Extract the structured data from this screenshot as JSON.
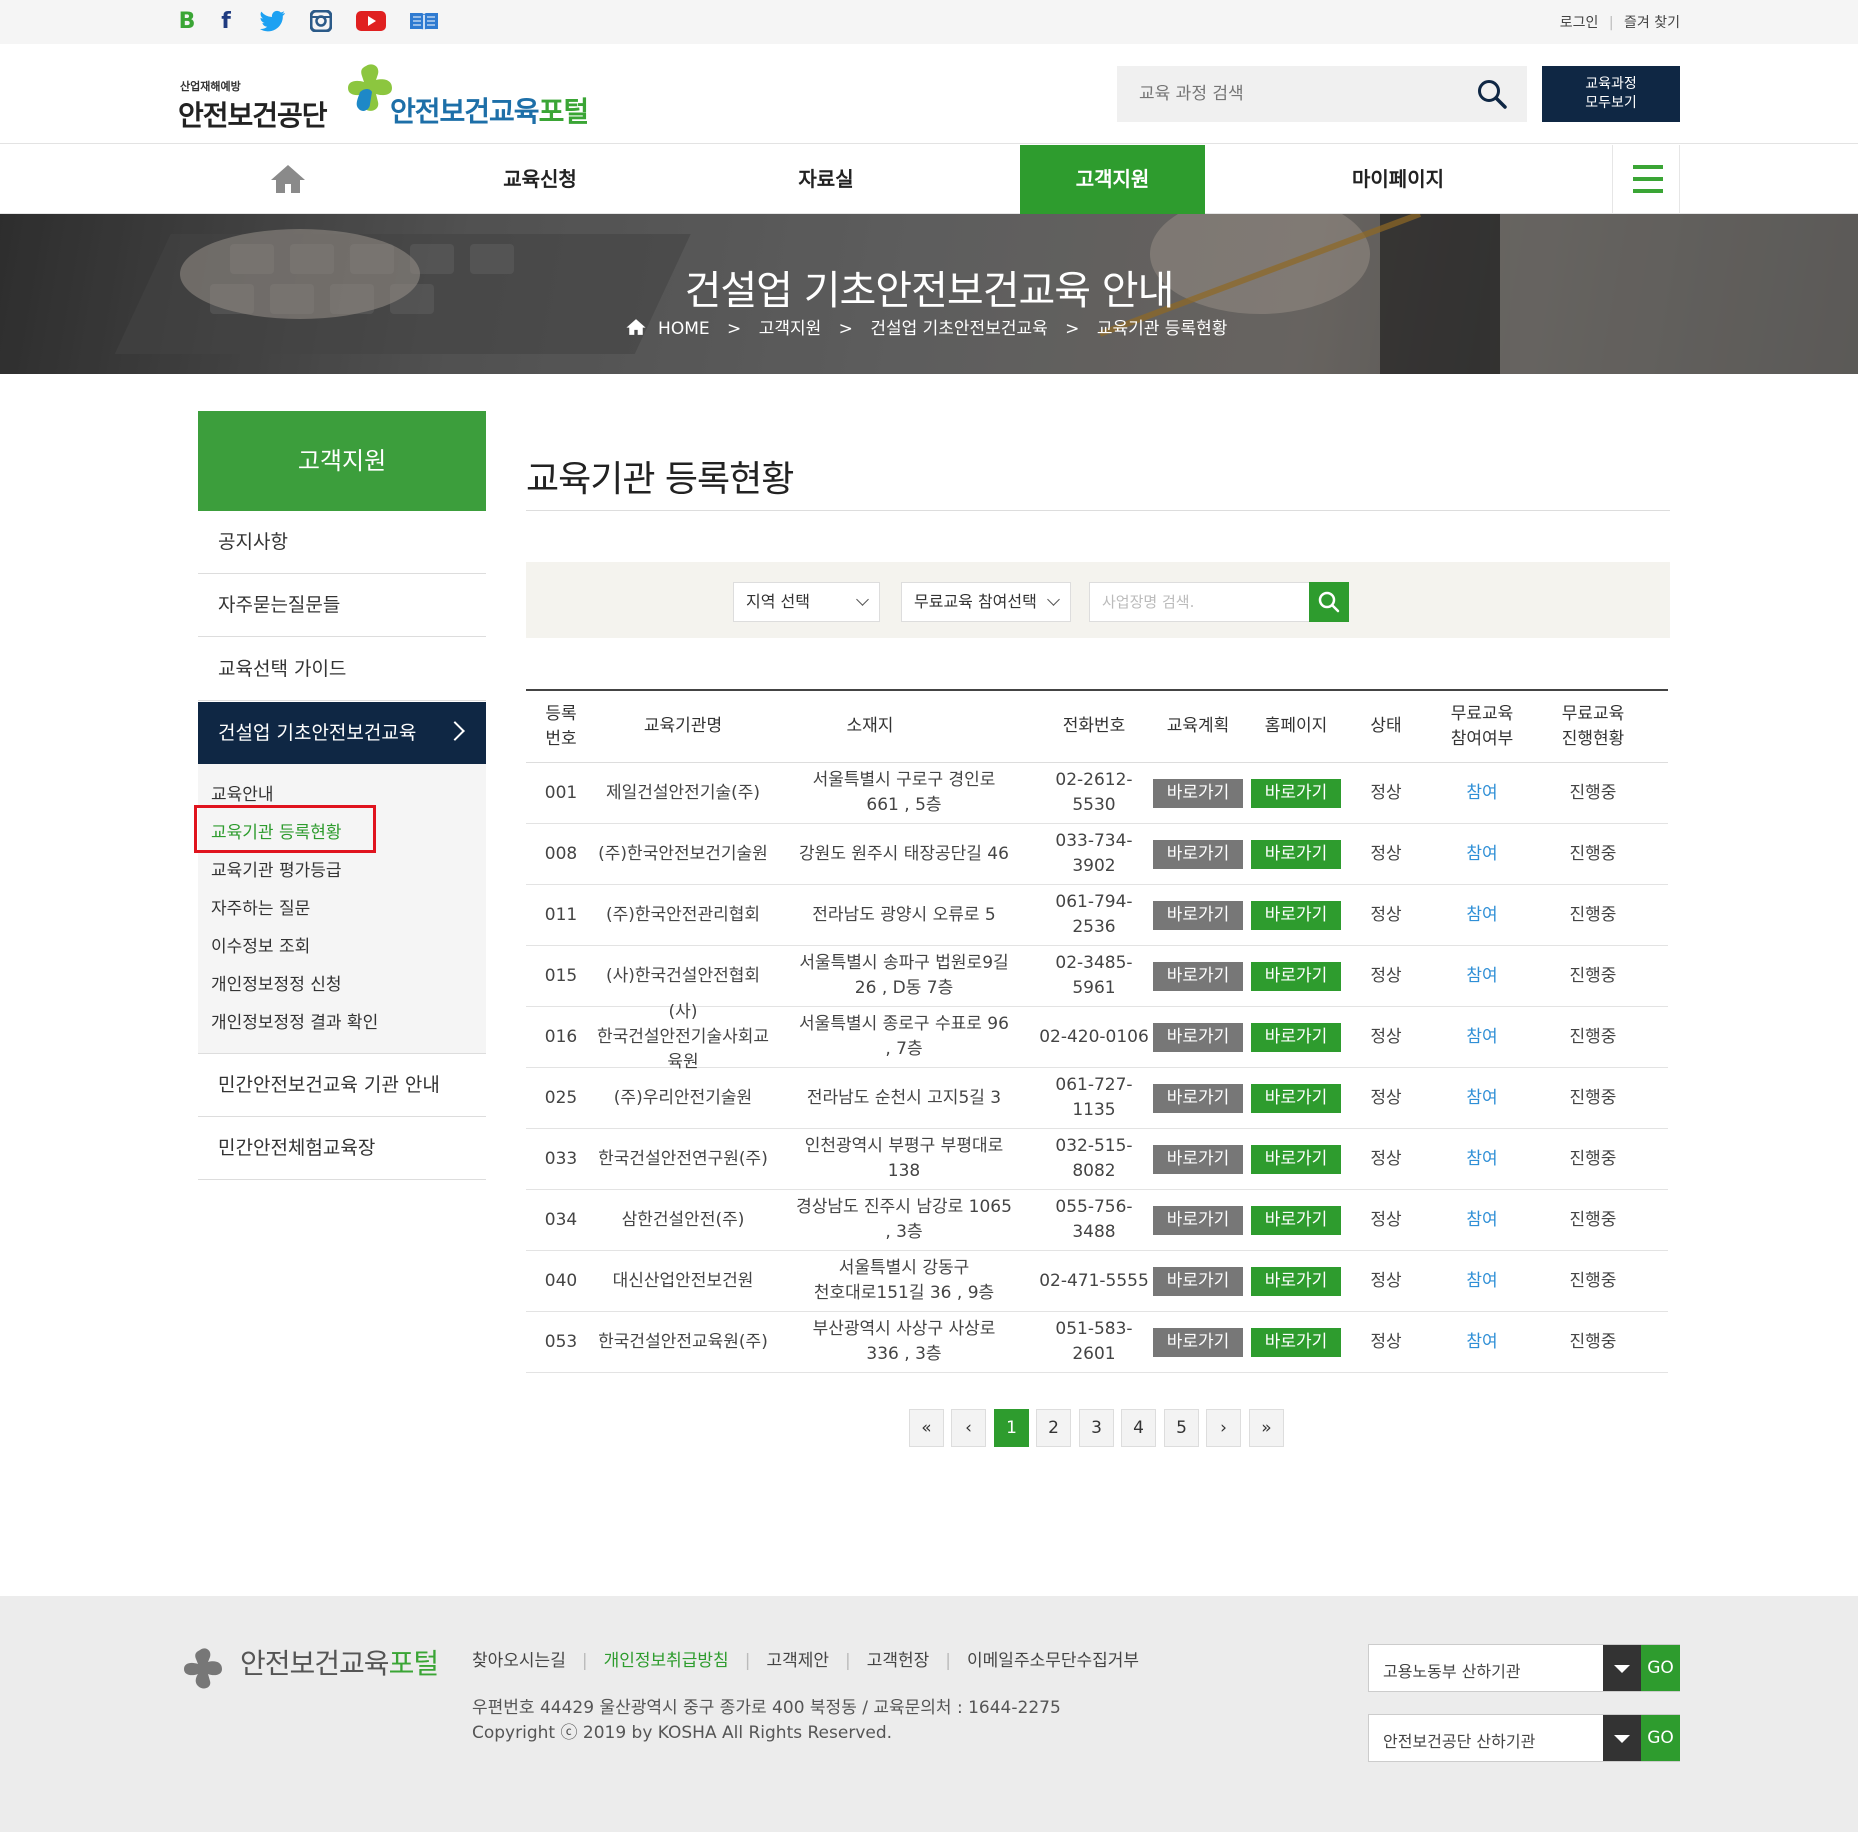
{
  "topbar": {
    "social_icons": [
      "blog-icon",
      "facebook-icon",
      "twitter-icon",
      "instagram-icon",
      "youtube-icon",
      "book-icon"
    ],
    "login": "로그인",
    "favorite": "즐겨 찾기"
  },
  "header": {
    "logo_small": "산업재해예방",
    "logo_main": "안전보건공단",
    "portal_blue": "안전보건교육",
    "portal_green": "포털",
    "search_placeholder": "교육 과정 검색",
    "all_courses_line1": "교육과정",
    "all_courses_line2": "모두보기"
  },
  "gnb": {
    "items": [
      "교육신청",
      "자료실",
      "고객지원",
      "마이페이지"
    ],
    "active": "고객지원"
  },
  "banner": {
    "title": "건설업 기초안전보건교육 안내",
    "breadcrumb": [
      "HOME",
      "고객지원",
      "건설업 기초안전보건교육",
      "교육기관 등록현황"
    ]
  },
  "lnb": {
    "title": "고객지원",
    "items": [
      "공지사항",
      "자주묻는질문들",
      "교육선택 가이드",
      "건설업 기초안전보건교육",
      "민간안전보건교육 기관 안내",
      "민간안전체험교육장"
    ],
    "sub_items": [
      "교육안내",
      "교육기관 등록현황",
      "교육기관 평가등급",
      "자주하는 질문",
      "이수정보 조회",
      "개인정보정정 신청",
      "개인정보정정 결과 확인"
    ]
  },
  "content": {
    "page_title": "교육기관 등록현황",
    "filter": {
      "region": "지역 선택",
      "free_edu": "무료교육 참여선택",
      "search_placeholder": "사업장명 검색."
    },
    "table": {
      "headers": {
        "no_1": "등록",
        "no_2": "번호",
        "name": "교육기관명",
        "address": "소재지",
        "phone": "전화번호",
        "plan": "교육계획",
        "homepage": "홈페이지",
        "status": "상태",
        "free_join_1": "무료교육",
        "free_join_2": "참여여부",
        "free_prog_1": "무료교육",
        "free_prog_2": "진행현황"
      },
      "button_label": "바로가기",
      "rows": [
        {
          "no": "001",
          "name": "제일건설안전기술(주)",
          "addr1": "서울특별시 구로구 경인로",
          "addr2": "661 , 5층",
          "phone": "02-2612-5530",
          "status": "정상",
          "join": "참여",
          "prog": "진행중"
        },
        {
          "no": "008",
          "name": "(주)한국안전보건기술원",
          "addr1": "강원도 원주시 태장공단길 46",
          "addr2": "",
          "phone": "033-734-3902",
          "status": "정상",
          "join": "참여",
          "prog": "진행중"
        },
        {
          "no": "011",
          "name": "(주)한국안전관리협회",
          "addr1": "전라남도 광양시 오류로 5",
          "addr2": "",
          "phone": "061-794-2536",
          "status": "정상",
          "join": "참여",
          "prog": "진행중"
        },
        {
          "no": "015",
          "name": "(사)한국건설안전협회",
          "addr1": "서울특별시 송파구 법원로9길",
          "addr2": "26 , D동 7층",
          "phone": "02-3485-5961",
          "status": "정상",
          "join": "참여",
          "prog": "진행중"
        },
        {
          "no": "016",
          "name": "(사)",
          "name2": "한국건설안전기술사회교육원",
          "addr1": "서울특별시 종로구 수표로 96",
          "addr2": ", 7층",
          "phone": "02-420-0106",
          "status": "정상",
          "join": "참여",
          "prog": "진행중"
        },
        {
          "no": "025",
          "name": "(주)우리안전기술원",
          "addr1": "전라남도 순천시 고지5길 3",
          "addr2": "",
          "phone": "061-727-1135",
          "status": "정상",
          "join": "참여",
          "prog": "진행중"
        },
        {
          "no": "033",
          "name": "한국건설안전연구원(주)",
          "addr1": "인천광역시 부평구 부평대로",
          "addr2": "138",
          "phone": "032-515-8082",
          "status": "정상",
          "join": "참여",
          "prog": "진행중"
        },
        {
          "no": "034",
          "name": "삼한건설안전(주)",
          "addr1": "경상남도 진주시 남강로 1065",
          "addr2": ", 3층",
          "phone": "055-756-3488",
          "status": "정상",
          "join": "참여",
          "prog": "진행중"
        },
        {
          "no": "040",
          "name": "대신산업안전보건원",
          "addr1": "서울특별시 강동구",
          "addr2": "천호대로151길 36 , 9층",
          "phone": "02-471-5555",
          "status": "정상",
          "join": "참여",
          "prog": "진행중"
        },
        {
          "no": "053",
          "name": "한국건설안전교육원(주)",
          "addr1": "부산광역시 사상구 사상로",
          "addr2": "336 , 3층",
          "phone": "051-583-2601",
          "status": "정상",
          "join": "참여",
          "prog": "진행중"
        }
      ]
    },
    "pagination": {
      "first": "«",
      "prev": "‹",
      "pages": [
        "1",
        "2",
        "3",
        "4",
        "5"
      ],
      "current": "1",
      "next": "›",
      "last": "»"
    }
  },
  "footer": {
    "logo_gray": "안전보건교육",
    "logo_green": "포털",
    "links": [
      "찾아오시는길",
      "개인정보취급방침",
      "고객제안",
      "고객헌장",
      "이메일주소무단수집거부"
    ],
    "highlight_link": "개인정보취급방침",
    "address": "우편번호 44429 울산광역시 중구 종가로 400 북정동 / 교육문의처 : 1644-2275",
    "copyright": "Copyright ⓒ 2019 by KOSHA All Rights Reserved.",
    "select1": "고용노동부 산하기관",
    "select2": "안전보건공단 산하기관",
    "go_label": "GO"
  },
  "colors": {
    "brand_green": "#2e9c2e",
    "navy": "#0f2744",
    "link_blue": "#2f8fd6",
    "highlight_red": "#e0141e"
  }
}
